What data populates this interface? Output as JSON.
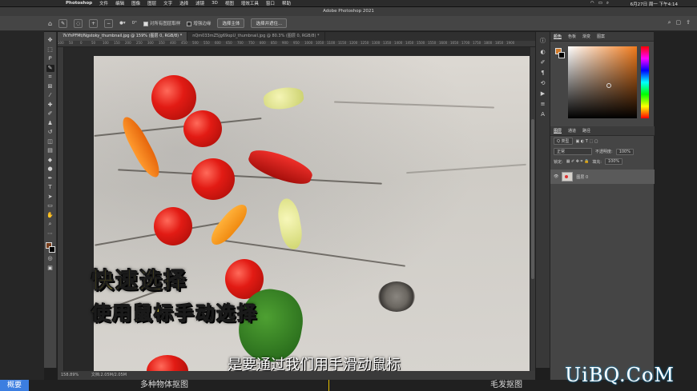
{
  "menubar": {
    "app_name": "Photoshop",
    "items": [
      "文件",
      "编辑",
      "图像",
      "图层",
      "文字",
      "选择",
      "滤镜",
      "3D",
      "视图",
      "增效工具",
      "窗口",
      "帮助"
    ],
    "clock": "6月27日 周一 下午4:14"
  },
  "window": {
    "title": "Adobe Photoshop 2021"
  },
  "options": {
    "angle": "0°",
    "sample_all_layers": "对所有图层取样",
    "enhance_edge": "增强边缘",
    "select_subject": "选择主体",
    "select_and_mask": "选择并遮住..."
  },
  "doc_tabs": [
    "7kYhPFMt/Ngstoky_thumbnail.jpg @ 159% (图层 0, RGB/8) *",
    "nQm033mZ5Jg69opU_thumbnail.jpg @ 80.3% (图层 0, RGB/8) *"
  ],
  "ruler": [
    "100",
    "50",
    "0",
    "50",
    "100",
    "150",
    "200",
    "250",
    "300",
    "350",
    "400",
    "450",
    "500",
    "550",
    "600",
    "650",
    "700",
    "750",
    "800",
    "850",
    "900",
    "950",
    "1000",
    "1050",
    "1100",
    "1150",
    "1200",
    "1250",
    "1300",
    "1350",
    "1400",
    "1450",
    "1500",
    "1550",
    "1600",
    "1650",
    "1700",
    "1750",
    "1800",
    "1850",
    "1900"
  ],
  "status": {
    "zoom": "158.89%",
    "doc": "文档:2.05M/2.05M"
  },
  "panels": {
    "color_tabs": [
      "颜色",
      "色板",
      "渐变",
      "图案"
    ],
    "layers_tabs": [
      "图层",
      "通道",
      "路径"
    ],
    "kind": "Q 类型",
    "blend": "正常",
    "opacity_label": "不透明度:",
    "opacity": "100%",
    "fill_label": "填充:",
    "fill": "100%",
    "lock_label": "锁定:",
    "layer_name": "图层 0"
  },
  "overlay": {
    "line1": "快速选择",
    "line2": "使用鼠标手动选择",
    "caption": "是要通过我们用手滑动鼠标"
  },
  "bottom_bar": {
    "first": "概要",
    "left": "多种物体抠图",
    "right": "毛发抠图"
  },
  "watermark": "UiBQ.CoM",
  "colors": {
    "foreground": "#d07a2a",
    "background": "#000000",
    "accent": "#3c7ee0"
  }
}
